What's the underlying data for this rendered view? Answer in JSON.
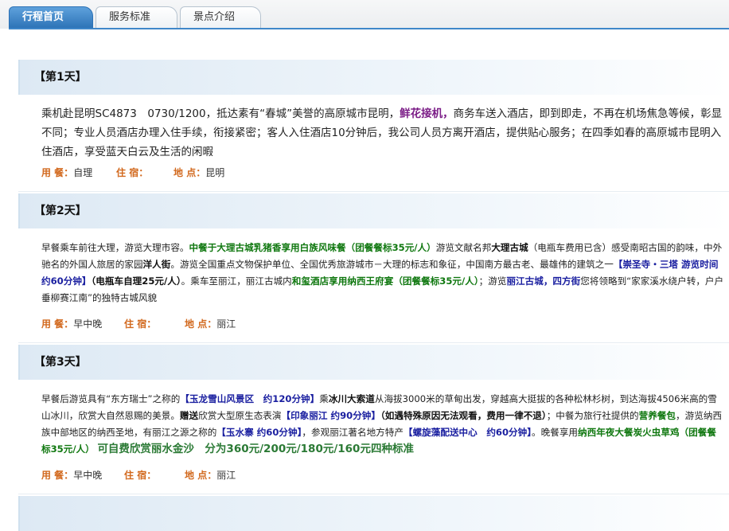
{
  "tabs": [
    {
      "label": "行程首页"
    },
    {
      "label": "服务标准"
    },
    {
      "label": "景点介绍"
    }
  ],
  "labels": {
    "meal": "用 餐：",
    "stay": "住 宿：",
    "place": "地 点："
  },
  "days": [
    {
      "header": "【第1天】",
      "p": [
        "乘机赴昆明SC4873　0730/1200，抵达素有“春城”美誉的高原城市昆明，",
        "鲜花接机，",
        "商务车送入酒店，即到即走，不再在机场焦急等候，彰显不同；专业人员酒店办理入住手续，衔接紧密；客人入住酒店10分钟后，我公司人员方离开酒店，提供贴心服务；在四季如春的高原城市昆明入住酒店，享受蓝天白云及生活的闲暇"
      ],
      "meal": "自理",
      "stay": "",
      "place": "昆明"
    },
    {
      "header": "【第2天】",
      "p": [
        "早餐乘车前往大理，游览大理市容。",
        "中餐于大理古城乳猪香享用白族风味餐（团餐餐标35元/人）",
        "游览文献名邦",
        "大理古城",
        "（电瓶车费用已含）感受南昭古国的韵味，中外驰名的外国人旅居的家园",
        "洋人街",
        "。游览全国重点文物保护单位、全国优秀旅游城市－大理的标志和象征，中国南方最古老、最雄伟的建筑之一",
        "【崇圣寺・三塔  游览时间约60分钟】",
        "（电瓶车自理25元/人）",
        "。乘车至丽江，丽江古城内",
        "和玺酒店享用纳西王府宴（团餐餐标35元/人）",
        "；游览",
        "丽江古城，四方街",
        "您将领略到“家家溪水绕户转，户户垂柳赛江南”的独特古城风貌"
      ],
      "meal": "早中晚",
      "stay": "",
      "place": "丽江"
    },
    {
      "header": "【第3天】",
      "p": [
        "早餐后游览具有“东方瑞士”之称的",
        "【玉龙雪山风景区　约120分钟】",
        "乘",
        "冰川大索道",
        "从海拔3000米的草甸出发，穿越高大挺拔的各种松林杉树，到达海拔4506米高的雪山冰川，欣赏大自然恩赐的美景。",
        "赠送",
        "欣赏大型原生态表演",
        "【印象丽江  约90分钟】",
        "（如遇特殊原因无法观看，费用一律不退）",
        "；中餐为旅行社提供的",
        "营养餐包",
        "，游览纳西族中部地区的纳西圣地，有丽江之源之称的",
        "【玉水寨  约60分钟】",
        "，参观丽江著名地方特产",
        "【螺旋藻配送中心　约60分钟】",
        "。晚餐享用",
        "纳西年夜大餐炭火虫草鸡（团餐餐标35元/人）",
        "可自费欣赏丽水金沙　分为360元/200元/180元/160元四种标准"
      ],
      "meal": "早中晚",
      "stay": "",
      "place": "丽江"
    }
  ]
}
